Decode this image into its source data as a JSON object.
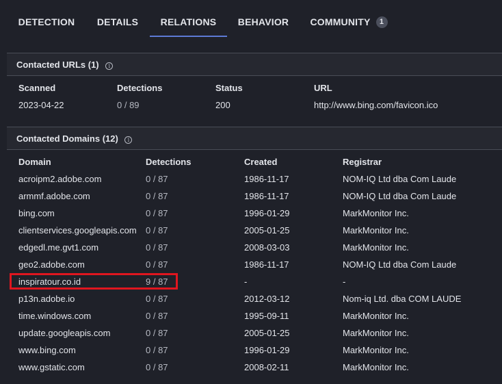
{
  "tabs": [
    {
      "label": "DETECTION"
    },
    {
      "label": "DETAILS"
    },
    {
      "label": "RELATIONS",
      "active": true
    },
    {
      "label": "BEHAVIOR"
    },
    {
      "label": "COMMUNITY",
      "badge": "1"
    }
  ],
  "contacted_urls": {
    "title": "Contacted URLs",
    "count": "(1)",
    "headers": [
      "Scanned",
      "Detections",
      "Status",
      "URL"
    ],
    "rows": [
      {
        "scanned": "2023-04-22",
        "detections": "0 / 89",
        "status": "200",
        "url": "http://www.bing.com/favicon.ico"
      }
    ]
  },
  "contacted_domains": {
    "title": "Contacted Domains",
    "count": "(12)",
    "headers": [
      "Domain",
      "Detections",
      "Created",
      "Registrar"
    ],
    "rows": [
      {
        "domain": "acroipm2.adobe.com",
        "detections": "0 / 87",
        "created": "1986-11-17",
        "registrar": "NOM-IQ Ltd dba Com Laude"
      },
      {
        "domain": "armmf.adobe.com",
        "detections": "0 / 87",
        "created": "1986-11-17",
        "registrar": "NOM-IQ Ltd dba Com Laude"
      },
      {
        "domain": "bing.com",
        "detections": "0 / 87",
        "created": "1996-01-29",
        "registrar": "MarkMonitor Inc."
      },
      {
        "domain": "clientservices.googleapis.com",
        "detections": "0 / 87",
        "created": "2005-01-25",
        "registrar": "MarkMonitor Inc."
      },
      {
        "domain": "edgedl.me.gvt1.com",
        "detections": "0 / 87",
        "created": "2008-03-03",
        "registrar": "MarkMonitor Inc."
      },
      {
        "domain": "geo2.adobe.com",
        "detections": "0 / 87",
        "created": "1986-11-17",
        "registrar": "NOM-IQ Ltd dba Com Laude"
      },
      {
        "domain": "inspiratour.co.id",
        "detections": "9 / 87",
        "created": "-",
        "registrar": "-",
        "highlighted": true
      },
      {
        "domain": "p13n.adobe.io",
        "detections": "0 / 87",
        "created": "2012-03-12",
        "registrar": "Nom-iq Ltd. dba COM LAUDE"
      },
      {
        "domain": "time.windows.com",
        "detections": "0 / 87",
        "created": "1995-09-11",
        "registrar": "MarkMonitor Inc."
      },
      {
        "domain": "update.googleapis.com",
        "detections": "0 / 87",
        "created": "2005-01-25",
        "registrar": "MarkMonitor Inc."
      },
      {
        "domain": "www.bing.com",
        "detections": "0 / 87",
        "created": "1996-01-29",
        "registrar": "MarkMonitor Inc."
      },
      {
        "domain": "www.gstatic.com",
        "detections": "0 / 87",
        "created": "2008-02-11",
        "registrar": "MarkMonitor Inc."
      }
    ]
  },
  "colors": {
    "background": "#1f2129",
    "accent": "#5d7bd6",
    "highlight": "#e0161f"
  }
}
